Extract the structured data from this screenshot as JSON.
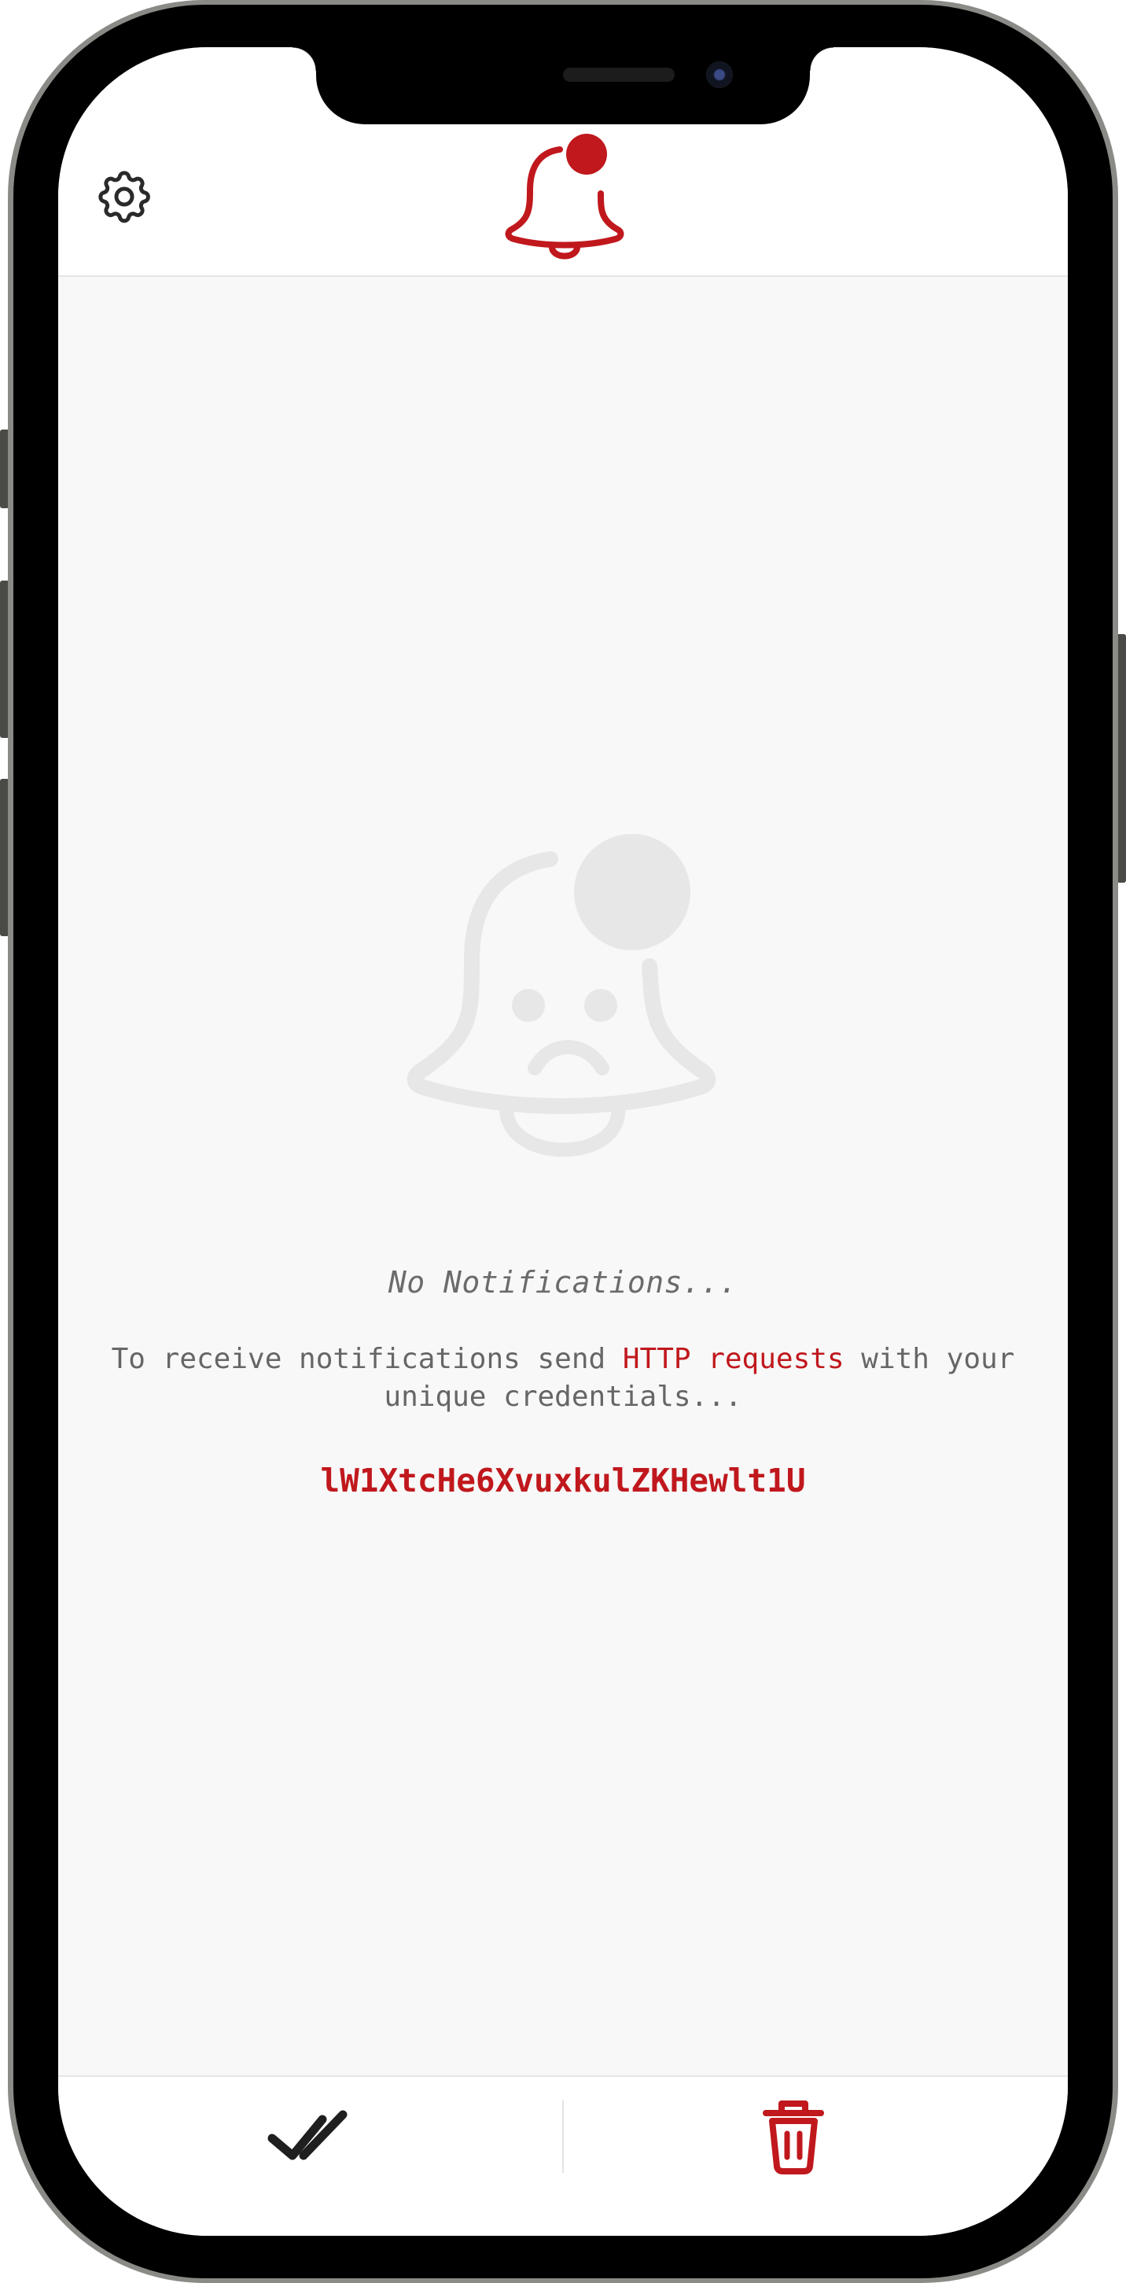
{
  "app": {
    "accent_color": "#c0181d",
    "logo_icon": "bell-with-badge-icon",
    "settings_icon": "gear-icon"
  },
  "empty_state": {
    "icon": "sad-bell-icon",
    "title": "No Notifications...",
    "instructions_before": "To receive notifications send ",
    "instructions_link": "HTTP requests",
    "instructions_after": " with your unique credentials...",
    "credential": "lW1XtcHe6XvuxkulZKHewlt1U"
  },
  "footer": {
    "mark_all_read_icon": "double-check-icon",
    "delete_all_icon": "trash-icon"
  }
}
